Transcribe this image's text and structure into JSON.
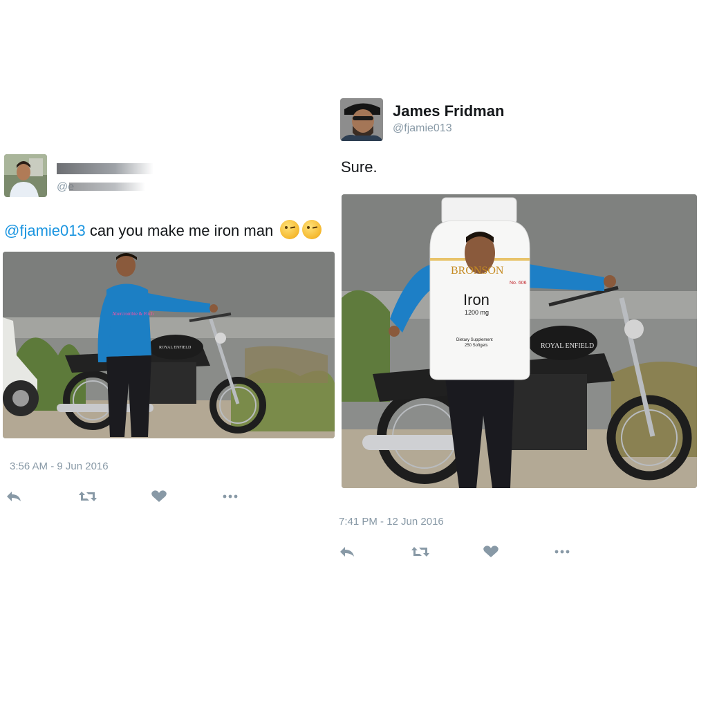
{
  "left_tweet": {
    "text_mention": "@fjamie013",
    "text_body": " can you make  me iron man",
    "emoji_names": [
      "winking-face-emoji",
      "winking-face-emoji"
    ],
    "photo": {
      "shirt_text": "Abercrombie & Fitch",
      "bike_brand": "ROYAL ENFIELD"
    },
    "timestamp": "3:56 AM - 9 Jun 2016",
    "actions": [
      "reply-icon",
      "retweet-icon",
      "like-icon",
      "more-icon"
    ]
  },
  "right_tweet": {
    "name": "James Fridman",
    "handle": "@fjamie013",
    "text": "Sure.",
    "photo": {
      "bottle_brand": "BRONSON",
      "bottle_no": "No. 606",
      "bottle_title": "Iron",
      "bottle_dose": "1200 mg",
      "bottle_desc": "Dietary Supplement",
      "bottle_count": "250 Softgels",
      "bike_brand": "ROYAL ENFIELD"
    },
    "timestamp": "7:41 PM - 12 Jun 2016",
    "actions": [
      "reply-icon",
      "retweet-icon",
      "like-icon",
      "more-icon"
    ]
  },
  "colors": {
    "link": "#1b95e0",
    "meta": "#8899a6",
    "text": "#14171a"
  }
}
